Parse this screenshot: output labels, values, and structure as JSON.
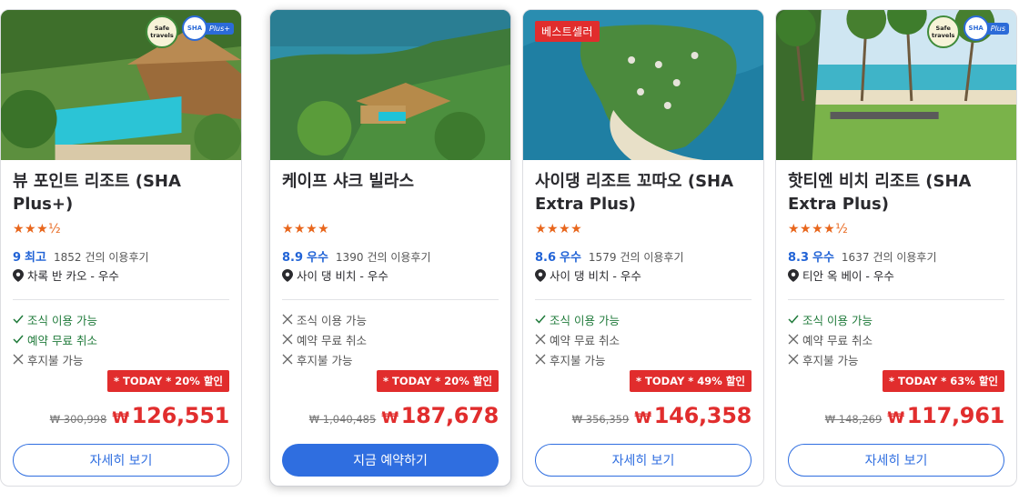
{
  "cards": [
    {
      "title": "케이프 샤크 빌라스",
      "stars": "★★★★",
      "score": "8.9",
      "score_word": "우수",
      "review_count": "1390",
      "review_suffix": "건의 이용후기",
      "location": "사이 댕 비치 - 우수",
      "features": [
        {
          "label": "조식 이용 가능",
          "available": false
        },
        {
          "label": "예약 무료 취소",
          "available": false
        },
        {
          "label": "후지불 가능",
          "available": false
        }
      ],
      "discount": "* TODAY * 20% 할인",
      "old_price": "₩ 1,040,485",
      "currency": "₩",
      "new_price": "187,678",
      "button": "지금 예약하기"
    },
    {
      "tag": "베스트셀러",
      "title": "사이댕 리조트 꼬따오 (SHA Extra Plus)",
      "stars": "★★★★",
      "score": "8.6",
      "score_word": "우수",
      "review_count": "1579",
      "review_suffix": "건의 이용후기",
      "location": "사이 댕 비치 - 우수",
      "features": [
        {
          "label": "조식 이용 가능",
          "available": true
        },
        {
          "label": "예약 무료 취소",
          "available": false
        },
        {
          "label": "후지불 가능",
          "available": false
        }
      ],
      "discount": "* TODAY * 49% 할인",
      "old_price": "₩ 356,359",
      "currency": "₩",
      "new_price": "146,358",
      "button": "자세히 보기"
    },
    {
      "title": "핫티엔 비치 리조트 (SHA Extra Plus)",
      "stars": "★★★★½",
      "score": "8.3",
      "score_word": "우수",
      "review_count": "1637",
      "review_suffix": "건의 이용후기",
      "location": "티안 옥 베이 - 우수",
      "badge_safe": "Safe travels",
      "badge_sha": "SHA",
      "badge_plus": "Plus",
      "features": [
        {
          "label": "조식 이용 가능",
          "available": true
        },
        {
          "label": "예약 무료 취소",
          "available": false
        },
        {
          "label": "후지불 가능",
          "available": false
        }
      ],
      "discount": "* TODAY * 63% 할인",
      "old_price": "₩ 148,269",
      "currency": "₩",
      "new_price": "117,961",
      "button": "자세히 보기"
    },
    {
      "title": "뷰 포인트 리조트 (SHA Plus+)",
      "stars": "★★★½",
      "score": "9",
      "score_word": "최고",
      "review_count": "1852",
      "review_suffix": "건의 이용후기",
      "location": "차록 반 카오 - 우수",
      "badge_safe": "Safe travels",
      "badge_sha": "SHA",
      "badge_plus": "Plus+",
      "features": [
        {
          "label": "조식 이용 가능",
          "available": true
        },
        {
          "label": "예약 무료 취소",
          "available": true
        },
        {
          "label": "후지불 가능",
          "available": false
        }
      ],
      "discount": "* TODAY * 20% 할인",
      "old_price": "₩ 300,998",
      "currency": "₩",
      "new_price": "126,551",
      "button": "자세히 보기"
    }
  ],
  "colors": {
    "accent": "#2f6ee0",
    "price_red": "#e12d2d",
    "star_orange": "#e8661c",
    "check_green": "#1f7a3a"
  }
}
